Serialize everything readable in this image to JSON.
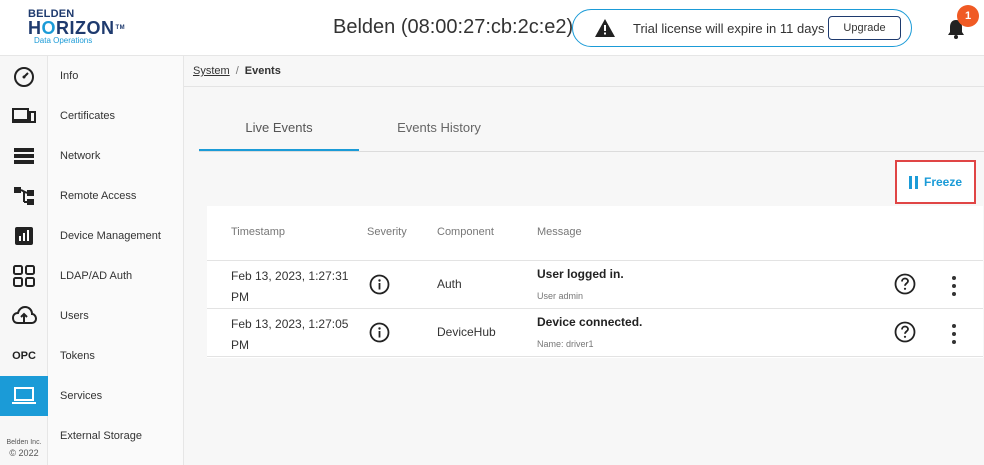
{
  "header": {
    "logo": {
      "line1": "BELDEN",
      "line2a": "H",
      "line2o": "O",
      "line2b": "RIZON",
      "tm": "TM",
      "line3": "Data Operations"
    },
    "device_title": "Belden (08:00:27:cb:2c:e2)",
    "trial_message": "Trial license will expire in 11 days",
    "upgrade_label": "Upgrade",
    "notification_count": "1"
  },
  "rail": {
    "items": [
      {
        "icon": "dashboard-gauge-icon"
      },
      {
        "icon": "devices-icon"
      },
      {
        "icon": "list-icon"
      },
      {
        "icon": "hierarchy-icon"
      },
      {
        "icon": "bar-chart-icon"
      },
      {
        "icon": "apps-grid-icon"
      },
      {
        "icon": "cloud-upload-icon"
      },
      {
        "label": "OPC"
      },
      {
        "icon": "laptop-icon",
        "active": true
      }
    ],
    "footer_company": "Belden Inc.",
    "footer_copyright": "© 2022"
  },
  "sidebar": {
    "items": [
      {
        "label": "Info"
      },
      {
        "label": "Certificates"
      },
      {
        "label": "Network"
      },
      {
        "label": "Remote Access"
      },
      {
        "label": "Device Management"
      },
      {
        "label": "LDAP/AD Auth"
      },
      {
        "label": "Users"
      },
      {
        "label": "Tokens"
      },
      {
        "label": "Services"
      },
      {
        "label": "External Storage"
      }
    ]
  },
  "breadcrumb": {
    "parent": "System",
    "separator": "/",
    "current": "Events"
  },
  "tabs": [
    {
      "label": "Live Events",
      "active": true
    },
    {
      "label": "Events History",
      "active": false
    }
  ],
  "freeze_label": "Freeze",
  "table": {
    "headers": [
      "Timestamp",
      "Severity",
      "Component",
      "Message"
    ],
    "rows": [
      {
        "timestamp": "Feb 13, 2023, 1:27:31 PM",
        "severity_icon": "info-circle-icon",
        "component": "Auth",
        "message_title": "User logged in.",
        "message_detail": "User admin"
      },
      {
        "timestamp": "Feb 13, 2023, 1:27:05 PM",
        "severity_icon": "info-circle-icon",
        "component": "DeviceHub",
        "message_title": "Device connected.",
        "message_detail": "Name: driver1"
      }
    ]
  },
  "colors": {
    "accent": "#1b9bd7",
    "brand_navy": "#1e3a6e",
    "badge": "#f05a24",
    "highlight": "#e04545"
  }
}
